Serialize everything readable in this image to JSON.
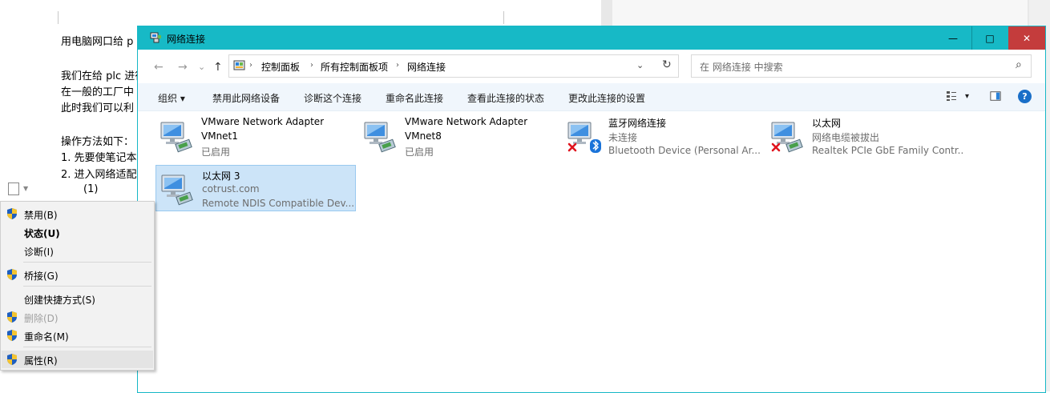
{
  "document": {
    "lines": [
      "用电脑网口给 p",
      "我们在给 plc 进行",
      "在一般的工厂中",
      "此时我们可以利",
      "操作方法如下：",
      "1.  先要使笔记本",
      "2.  进入网络适配",
      "(1)"
    ]
  },
  "window": {
    "title": "网络连接",
    "controls": {
      "minimize": "—",
      "maximize": "□",
      "close": "✕"
    },
    "nav": {
      "back": "←",
      "forward": "→",
      "recent": "⌄",
      "up": "↑"
    },
    "address": {
      "crumbs": [
        "控制面板",
        "所有控制面板项",
        "网络连接"
      ],
      "separator": "›",
      "dropdown": "⌄",
      "refresh": "↻"
    },
    "search": {
      "placeholder": "在 网络连接 中搜索",
      "icon": "⌕"
    },
    "commands": {
      "organize": "组织 ▾",
      "disable": "禁用此网络设备",
      "diagnose": "诊断这个连接",
      "rename": "重命名此连接",
      "status": "查看此连接的状态",
      "settings": "更改此连接的设置",
      "view_caret": "▾",
      "help": "?"
    },
    "connections": [
      {
        "name": "VMware Network Adapter",
        "line2": "VMnet1",
        "line3": "已启用",
        "icon": "network-adapter-icon"
      },
      {
        "name": "VMware Network Adapter",
        "line2": "VMnet8",
        "line3": "已启用",
        "icon": "network-adapter-icon"
      },
      {
        "name": "蓝牙网络连接",
        "line2": "未连接",
        "line3": "Bluetooth Device (Personal Ar...",
        "icon": "bluetooth-adapter-icon"
      },
      {
        "name": "以太网",
        "line2": "网络电缆被拔出",
        "line3": "Realtek PCIe GbE Family Contr...",
        "icon": "network-adapter-icon"
      },
      {
        "name": "以太网 3",
        "line2": "cotrust.com",
        "line3": "Remote NDIS Compatible Dev...",
        "icon": "network-adapter-icon"
      }
    ]
  },
  "context_menu": {
    "items": [
      {
        "label": "禁用(B)",
        "shield": true
      },
      {
        "label": "状态(U)",
        "shield": false,
        "bold": true
      },
      {
        "label": "诊断(I)",
        "shield": false
      },
      {
        "label": "桥接(G)",
        "shield": true
      },
      {
        "label": "创建快捷方式(S)",
        "shield": false
      },
      {
        "label": "删除(D)",
        "shield": true,
        "disabled": true
      },
      {
        "label": "重命名(M)",
        "shield": true
      },
      {
        "label": "属性(R)",
        "shield": true,
        "highlighted": true
      }
    ]
  },
  "colors": {
    "titlebar": "#17b9c6",
    "close_button": "#c43c3c",
    "selection": "#cce4f8",
    "error_x": "#e0141e",
    "bluetooth": "#1a73d9"
  }
}
